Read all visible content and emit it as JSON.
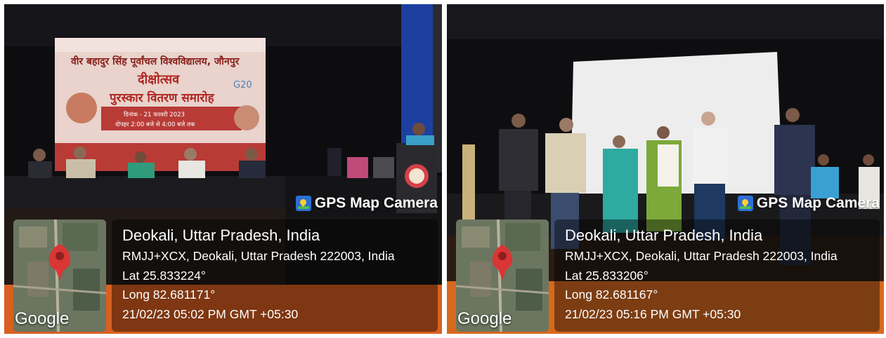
{
  "photos": [
    {
      "scene": {
        "banner_header": "वीर बहादुर सिंह पूर्वांचल विश्वविद्यालय, जौनपुर",
        "banner_title": "दीक्षोत्सव",
        "banner_subtitle": "पुरस्कार वितरण समारोह",
        "banner_date": "दिनांक - 21 फरवरी 2023",
        "banner_time": "दोपहर 2:00 बजे से 4:00 बजे तक",
        "banner_g20": "G20"
      },
      "brand": "GPS Map Camera",
      "map_label": "Google",
      "location_title": "Deokali, Uttar Pradesh, India",
      "address": "RMJJ+XCX, Deokali, Uttar Pradesh 222003, India",
      "lat": "Lat 25.833224°",
      "long": "Long 82.681171°",
      "timestamp": "21/02/23 05:02 PM GMT +05:30"
    },
    {
      "brand": "GPS Map Camera",
      "map_label": "Google",
      "location_title": "Deokali, Uttar Pradesh, India",
      "address": "RMJJ+XCX, Deokali, Uttar Pradesh 222003, India",
      "lat": "Lat 25.833206°",
      "long": "Long 82.681167°",
      "timestamp": "21/02/23 05:16 PM GMT +05:30"
    }
  ],
  "colors": {
    "pin": "#d93636",
    "overlay": "#000000",
    "brand_icon": "#2b6fd6",
    "stage_floor": "#e06a22"
  }
}
